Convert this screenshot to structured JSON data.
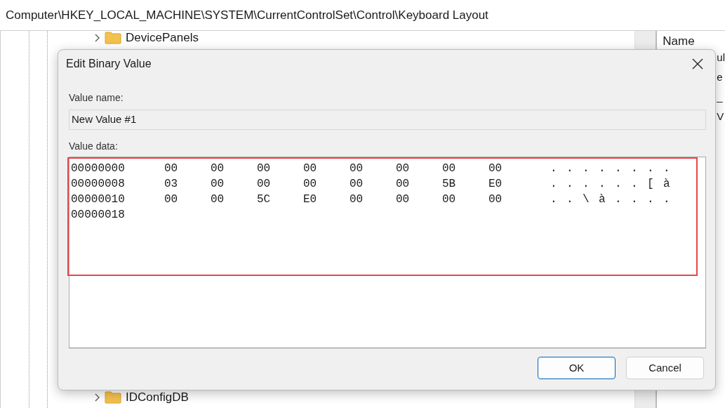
{
  "address_bar": {
    "path": "Computer\\HKEY_LOCAL_MACHINE\\SYSTEM\\CurrentControlSet\\Control\\Keyboard Layout"
  },
  "tree": {
    "items": [
      {
        "label": "DevicePanels",
        "expanded": false
      },
      {
        "label": "IDConfigDB",
        "expanded": false
      }
    ]
  },
  "list_panel": {
    "column": "Name",
    "fragments": [
      "ul",
      "e",
      "_",
      "V"
    ]
  },
  "dialog": {
    "title": "Edit Binary Value",
    "value_name_label": "Value name:",
    "value_name": "New Value #1",
    "value_data_label": "Value data:",
    "rows": [
      {
        "address": "00000000",
        "bytes": [
          "00",
          "00",
          "00",
          "00",
          "00",
          "00",
          "00",
          "00"
        ],
        "ascii": [
          ".",
          ".",
          ".",
          ".",
          ".",
          ".",
          ".",
          "."
        ]
      },
      {
        "address": "00000008",
        "bytes": [
          "03",
          "00",
          "00",
          "00",
          "00",
          "00",
          "5B",
          "E0"
        ],
        "ascii": [
          ".",
          ".",
          ".",
          ".",
          ".",
          ".",
          "[",
          "à"
        ]
      },
      {
        "address": "00000010",
        "bytes": [
          "00",
          "00",
          "5C",
          "E0",
          "00",
          "00",
          "00",
          "00"
        ],
        "ascii": [
          ".",
          ".",
          "\\",
          "à",
          ".",
          ".",
          ".",
          "."
        ]
      },
      {
        "address": "00000018",
        "bytes": [],
        "ascii": []
      }
    ],
    "buttons": [
      {
        "label": "OK",
        "default": true
      },
      {
        "label": "Cancel",
        "default": false
      }
    ]
  }
}
